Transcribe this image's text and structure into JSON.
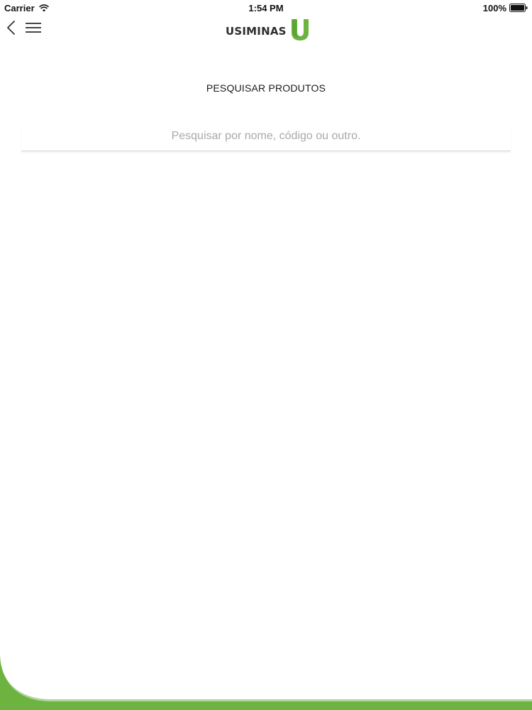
{
  "status_bar": {
    "carrier": "Carrier",
    "time": "1:54 PM",
    "battery": "100%",
    "icons": [
      "wifi-icon",
      "battery-icon"
    ]
  },
  "nav": {
    "back_icon": "chevron-left-icon",
    "menu_icon": "hamburger-menu-icon",
    "logo_text": "USIMINAS"
  },
  "page": {
    "title": "PESQUISAR PRODUTOS"
  },
  "search": {
    "value": "",
    "placeholder": "Pesquisar por nome, código ou outro."
  },
  "colors": {
    "brand_green": "#6cb33f",
    "text_dark": "#222222",
    "placeholder": "#a9a9a9"
  }
}
